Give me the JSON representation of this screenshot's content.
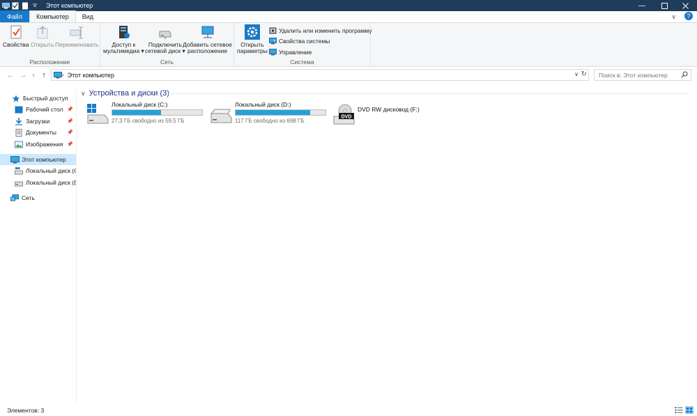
{
  "window": {
    "title": "Этот компьютер"
  },
  "tabs": [
    {
      "label": "Файл"
    },
    {
      "label": "Компьютер"
    },
    {
      "label": "Вид"
    }
  ],
  "ribbon": {
    "location": {
      "label": "Расположение",
      "properties": "Свойства",
      "open": "Открыть",
      "rename": "Переименовать"
    },
    "network": {
      "label": "Сеть",
      "media_line1": "Доступ к",
      "media_line2": "мультимедиа",
      "map_line1": "Подключить",
      "map_line2": "сетевой диск",
      "add_line1": "Добавить сетевое",
      "add_line2": "расположение"
    },
    "system": {
      "label": "Система",
      "settings_line1": "Открыть",
      "settings_line2": "параметры",
      "uninstall": "Удалить или изменить программу",
      "sysprops": "Свойства системы",
      "manage": "Управление"
    }
  },
  "address": {
    "crumb": "Этот компьютер",
    "search_placeholder": "Поиск в: Этот компьютер"
  },
  "sidebar": {
    "items": [
      {
        "label": "Быстрый доступ"
      },
      {
        "label": "Рабочий стол"
      },
      {
        "label": "Загрузки"
      },
      {
        "label": "Документы"
      },
      {
        "label": "Изображения"
      },
      {
        "label": "Этот компьютер"
      },
      {
        "label": "Локальный диск (C"
      },
      {
        "label": "Локальный диск (D"
      },
      {
        "label": "Сеть"
      }
    ]
  },
  "content": {
    "section_title": "Устройства и диски (3)",
    "drives": [
      {
        "name": "Локальный диск (C:)",
        "free": "27,3 ГБ свободно из 59,5 ГБ",
        "used_fraction": 0.54
      },
      {
        "name": "Локальный диск (D:)",
        "free": "117 ГБ свободно из 698 ГБ",
        "used_fraction": 0.83
      },
      {
        "name": "DVD RW дисковод (F:)"
      }
    ],
    "dvd_label": "DVD"
  },
  "status": {
    "count": "Элементов: 3"
  },
  "colors": {
    "accent": "#1979ca",
    "titlebar": "#1f3c5a",
    "selection": "#cce8ff",
    "bar_fill": "#26a0da"
  }
}
